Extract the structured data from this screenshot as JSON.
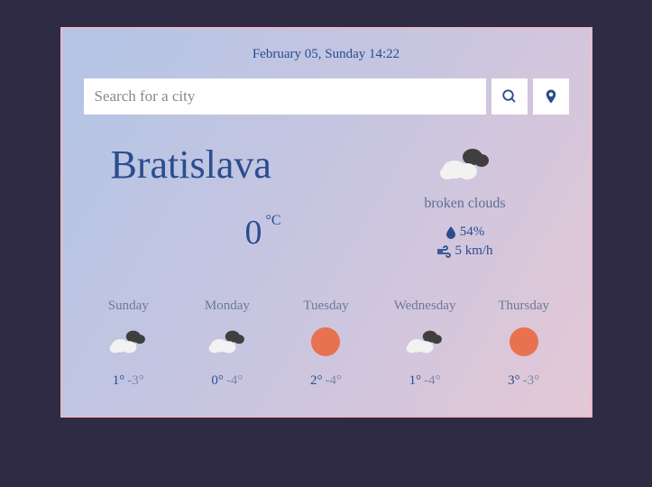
{
  "date": "February 05, Sunday 14:22",
  "search": {
    "placeholder": "Search for a city"
  },
  "current": {
    "city": "Bratislava",
    "temp": "0",
    "unit": "°C",
    "condition": "broken clouds",
    "humidity": "54%",
    "wind": "5 km/h",
    "icon": "clouds"
  },
  "forecast": [
    {
      "day": "Sunday",
      "hi": "1°",
      "lo": "-3°",
      "icon": "clouds"
    },
    {
      "day": "Monday",
      "hi": "0°",
      "lo": "-4°",
      "icon": "clouds"
    },
    {
      "day": "Tuesday",
      "hi": "2°",
      "lo": "-4°",
      "icon": "sun"
    },
    {
      "day": "Wednesday",
      "hi": "1°",
      "lo": "-4°",
      "icon": "clouds"
    },
    {
      "day": "Thursday",
      "hi": "3°",
      "lo": "-3°",
      "icon": "sun"
    }
  ]
}
